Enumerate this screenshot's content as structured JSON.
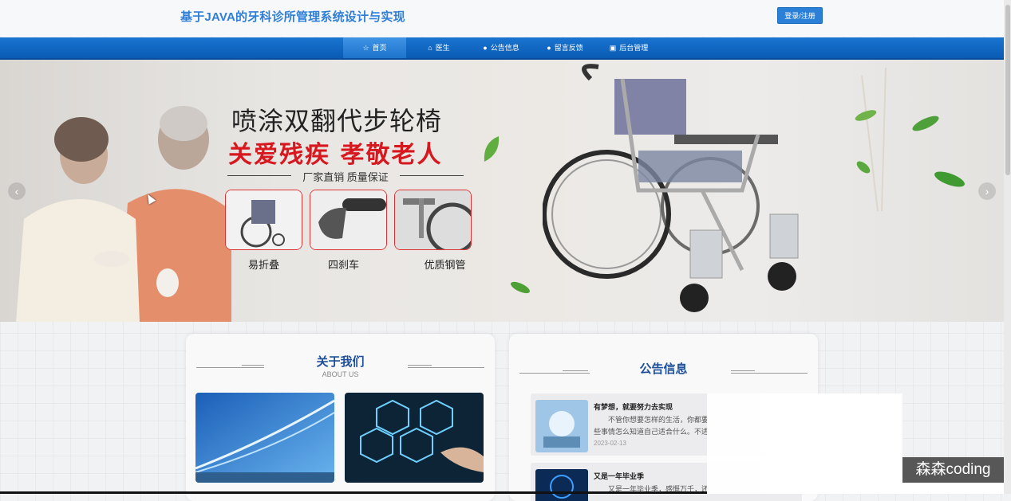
{
  "header": {
    "site_title": "基于JAVA的牙科诊所管理系统设计与实现",
    "login_label": "登录/注册"
  },
  "nav": {
    "items": [
      {
        "label": "首页",
        "icon": "home-icon",
        "active": true
      },
      {
        "label": "医生",
        "icon": "lock-icon",
        "active": false
      },
      {
        "label": "公告信息",
        "icon": "info-icon",
        "active": false
      },
      {
        "label": "留言反馈",
        "icon": "info-icon",
        "active": false
      },
      {
        "label": "后台管理",
        "icon": "briefcase-icon",
        "active": false
      }
    ]
  },
  "banner": {
    "headline": "喷涂双翻代步轮椅",
    "slogan": "关爱残疾  孝敬老人",
    "subline": "厂家直销  质量保证",
    "features": [
      "易折叠",
      "四刹车",
      "优质钢管"
    ],
    "prev_arrow": "‹",
    "next_arrow": "›"
  },
  "about": {
    "title": "关于我们",
    "subtitle": "ABOUT US"
  },
  "notices": {
    "title": "公告信息",
    "items": [
      {
        "title": "有梦想，就要努力去实现",
        "desc": "不管你想要怎样的生活，你都要",
        "desc2": "些事情怎么知道自己适合什么。不适",
        "date": "2023-02-13"
      },
      {
        "title": "又是一年毕业季",
        "desc": "又是一年毕业季，感慨万千，还"
      }
    ]
  },
  "watermark": "森森coding",
  "colors": {
    "accent": "#2a7fd6",
    "nav_bg": "#0a5bb3",
    "title_blue": "#1d4f9a",
    "slogan_red": "#d7191f"
  }
}
